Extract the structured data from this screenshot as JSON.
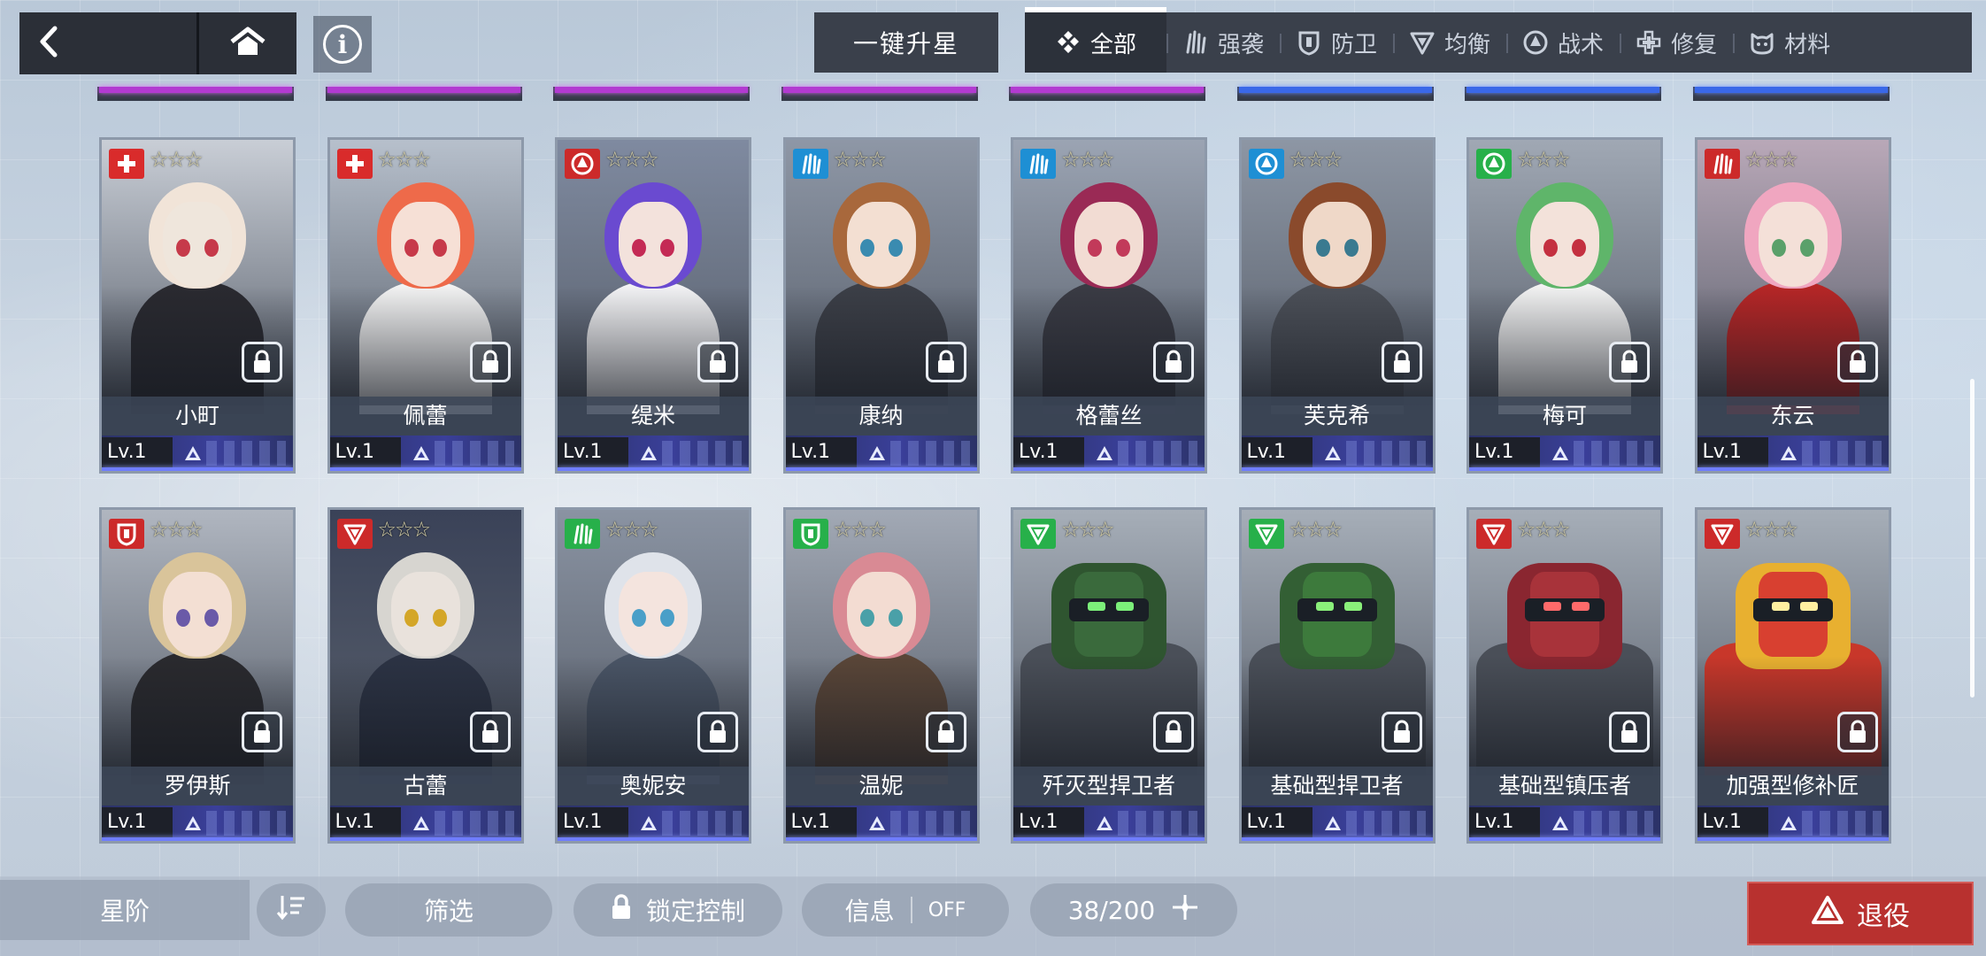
{
  "topbar": {
    "back_icon": "chevron-left-icon",
    "home_icon": "home-icon",
    "info_label": "i",
    "upstar_label": "一键升星"
  },
  "tabs": [
    {
      "id": "all",
      "label": "全部",
      "icon": "diamond-cluster-icon",
      "active": true
    },
    {
      "id": "assault",
      "label": "强袭",
      "icon": "claw-icon",
      "active": false
    },
    {
      "id": "defense",
      "label": "防卫",
      "icon": "shield-icon",
      "active": false
    },
    {
      "id": "balance",
      "label": "均衡",
      "icon": "triangle-down-icon",
      "active": false
    },
    {
      "id": "tactics",
      "label": "战术",
      "icon": "circle-arrow-icon",
      "active": false
    },
    {
      "id": "repair",
      "label": "修复",
      "icon": "cross-icon",
      "active": false
    },
    {
      "id": "material",
      "label": "材料",
      "icon": "cat-face-icon",
      "active": false
    }
  ],
  "colors": {
    "repair": "#d92b2b",
    "tactics_red": "#cc2a2a",
    "tactics_blue": "#1e8fd4",
    "assault_blue": "#1e8fd4",
    "tactics_green": "#27b04a",
    "assault_green": "#27b04a",
    "defense_green": "#27b04a",
    "defense_red": "#cc2a2a",
    "balance_red": "#cc2a2a",
    "balance_green": "#27b04a",
    "assault_red": "#cc2a2a",
    "rarity_purple": "#b23ad1",
    "rarity_blue": "#3a68e8",
    "retire": "#b8312f"
  },
  "top_rarity_bars": [
    "purple",
    "purple",
    "purple",
    "purple",
    "purple",
    "blue",
    "blue",
    "blue"
  ],
  "units": [
    {
      "name": "小町",
      "level": "Lv.1",
      "class": "repair",
      "badge_color": "#d92b2b",
      "stars": "☆☆☆",
      "skin": "#efe6dc",
      "hair": "#f1e4d8",
      "eyes": "#c63a4a",
      "outfit": "#2a2a30",
      "bg": "#c9ced6",
      "mech": false
    },
    {
      "name": "佩蕾",
      "level": "Lv.1",
      "class": "repair",
      "badge_color": "#d92b2b",
      "stars": "☆☆☆",
      "skin": "#f6e0d6",
      "hair": "#ee6a4a",
      "eyes": "#c73a4a",
      "outfit": "#f2f2f2",
      "bg": "#b7c0cc",
      "mech": false
    },
    {
      "name": "缇米",
      "level": "Lv.1",
      "class": "tactics",
      "badge_color": "#cc2a2a",
      "stars": "☆☆☆",
      "skin": "#f3e2dc",
      "hair": "#6a4ad0",
      "eyes": "#c42a55",
      "outfit": "#f2f2f4",
      "bg": "#7f8aa0",
      "mech": false
    },
    {
      "name": "康纳",
      "level": "Lv.1",
      "class": "assault",
      "badge_color": "#1e8fd4",
      "stars": "☆☆☆",
      "skin": "#f3dfd2",
      "hair": "#a8683c",
      "eyes": "#3a8bb0",
      "outfit": "#3c3f47",
      "bg": "#8e97a6",
      "mech": false
    },
    {
      "name": "格蕾丝",
      "level": "Lv.1",
      "class": "assault",
      "badge_color": "#1e8fd4",
      "stars": "☆☆☆",
      "skin": "#f2dcd3",
      "hair": "#9a2a55",
      "eyes": "#c23a5a",
      "outfit": "#3a3b44",
      "bg": "#9ba4b3",
      "mech": false
    },
    {
      "name": "芙克希",
      "level": "Lv.1",
      "class": "tactics",
      "badge_color": "#1e8fd4",
      "stars": "☆☆☆",
      "skin": "#efd8c8",
      "hair": "#8a4a2c",
      "eyes": "#3a7a90",
      "outfit": "#4c5058",
      "bg": "#8d96a4",
      "mech": false
    },
    {
      "name": "梅可",
      "level": "Lv.1",
      "class": "tactics",
      "badge_color": "#27b04a",
      "stars": "☆☆☆",
      "skin": "#f3e2da",
      "hair": "#5fb56a",
      "eyes": "#c43040",
      "outfit": "#f2f2f2",
      "bg": "#a0a8b4",
      "mech": false
    },
    {
      "name": "东云",
      "level": "Lv.1",
      "class": "assault",
      "badge_color": "#cc2a2a",
      "stars": "☆☆☆",
      "skin": "#f4e0d8",
      "hair": "#f0a6c0",
      "eyes": "#5aa06a",
      "outfit": "#b62626",
      "bg": "#b9a8b8",
      "mech": false
    },
    {
      "name": "罗伊斯",
      "level": "Lv.1",
      "class": "defense",
      "badge_color": "#cc2a2a",
      "stars": "☆☆☆",
      "skin": "#f3dfd3",
      "hair": "#d9c49a",
      "eyes": "#6a5aa8",
      "outfit": "#2a2a2e",
      "bg": "#b0b6c0",
      "mech": false
    },
    {
      "name": "古蕾",
      "level": "Lv.1",
      "class": "balance",
      "badge_color": "#cc2a2a",
      "stars": "☆☆☆",
      "skin": "#e9e2dc",
      "hair": "#d7d5d0",
      "eyes": "#d4a628",
      "outfit": "#2c3344",
      "bg": "#3a4258",
      "mech": false
    },
    {
      "name": "奥妮安",
      "level": "Lv.1",
      "class": "assault",
      "badge_color": "#27b04a",
      "stars": "☆☆☆",
      "skin": "#f4e4de",
      "hair": "#dfe3ea",
      "eyes": "#4a9fc8",
      "outfit": "#4a5566",
      "bg": "#8a93a2",
      "mech": false
    },
    {
      "name": "温妮",
      "level": "Lv.1",
      "class": "defense",
      "badge_color": "#27b04a",
      "stars": "☆☆☆",
      "skin": "#f3dcd2",
      "hair": "#d98a94",
      "eyes": "#4aa0a8",
      "outfit": "#5a4638",
      "bg": "#a2a9b5",
      "mech": false
    },
    {
      "name": "歼灭型捍卫者",
      "level": "Lv.1",
      "class": "balance",
      "badge_color": "#27b04a",
      "stars": "☆☆☆",
      "skin": "#3a6a3c",
      "hair": "#2f5530",
      "eyes": "#7cf07a",
      "outfit": "#4a4f58",
      "bg": "#a6aeb8",
      "mech": true
    },
    {
      "name": "基础型捍卫者",
      "level": "Lv.1",
      "class": "balance",
      "badge_color": "#27b04a",
      "stars": "☆☆☆",
      "skin": "#3d7a3c",
      "hair": "#335f34",
      "eyes": "#8af07a",
      "outfit": "#4a4f58",
      "bg": "#a6aeb8",
      "mech": true
    },
    {
      "name": "基础型镇压者",
      "level": "Lv.1",
      "class": "balance",
      "badge_color": "#cc2a2a",
      "stars": "☆☆☆",
      "skin": "#a8333a",
      "hair": "#8a2630",
      "eyes": "#ff6a6a",
      "outfit": "#4a4f58",
      "bg": "#a6aeb8",
      "mech": true
    },
    {
      "name": "加强型修补匠",
      "level": "Lv.1",
      "class": "balance",
      "badge_color": "#cc2a2a",
      "stars": "☆☆☆",
      "skin": "#d84030",
      "hair": "#e8b030",
      "eyes": "#fff0a0",
      "outfit": "#c8372a",
      "bg": "#a6aeb8",
      "mech": true
    }
  ],
  "bottom": {
    "star_sort_label": "星阶",
    "sort_icon": "sort-order-icon",
    "filter_label": "筛选",
    "lock_label": "锁定控制",
    "info_label": "信息",
    "info_toggle": "OFF",
    "capacity": "38/200",
    "expand_icon": "plus-sparkle-icon",
    "retire_label": "退役",
    "retire_icon": "recycle-triangle-icon"
  }
}
